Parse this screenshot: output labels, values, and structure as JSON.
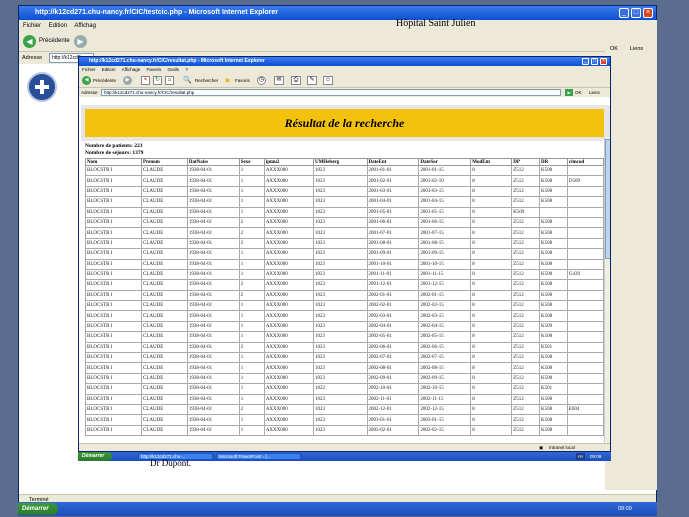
{
  "outer": {
    "title": "http://k12cd271.chu-nancy.fr/CIC/testcic.php - Microsoft Internet Explorer",
    "menu": [
      "Fichier",
      "Edition",
      "Affichag"
    ],
    "back_label": "Précédente",
    "address_label": "Adresse",
    "address_value": "http://k12cd2",
    "ok_label": "OK",
    "links_label": "Liens",
    "status_text": "Terminé",
    "slide_header": "Hôpital Saint Julien",
    "slide_signature": "Dr Dupont.",
    "taskbar": {
      "start_label": "Démarrer",
      "clock": "09:09"
    }
  },
  "inner": {
    "title": "http://k12cd271.chu-nancy.fr/CIC/resultat.php - Microsoft Internet Explorer",
    "menu": [
      "Fichier",
      "Edition",
      "Affichage",
      "Favoris",
      "Outils",
      "?"
    ],
    "toolbar": {
      "back_label": "Précédente",
      "search_label": "Rechercher",
      "favorites_label": "Favoris"
    },
    "address_label": "Adresse",
    "address_value": "http://k12cd271.chu-nancy.fr/CIC/resultat.php",
    "go_label": "OK",
    "links_label": "Liens",
    "status_right": "Intranet local",
    "taskbar": {
      "start_label": "Démarrer",
      "tasks": [
        "http://k12cd271.chu-...",
        "Microsoft PowerPoint - [..."
      ],
      "lang": "FR",
      "clock": "09:09"
    }
  },
  "result": {
    "title": "Résultat de la recherche",
    "patients_line": "Nombre de patients:  223",
    "stays_line": "Nombre de séjours:  1379",
    "columns": [
      "Nom",
      "Prenom",
      "DatNaiss",
      "Sexe",
      "ipmu2",
      "UMHeberg",
      "DateEnt",
      "DateSor",
      "ModEnt",
      "DP",
      "DR",
      "cimcod"
    ],
    "rows": [
      [
        "BLOCSTR I",
        "CLAUDE",
        "1938-04-01",
        "1",
        "AXXX000",
        "1023",
        "2001-01-01",
        "2001-01-15",
        "8",
        "Z512",
        "K508",
        ""
      ],
      [
        "BLOCSTR I",
        "CLAUDE",
        "1938-04-01",
        "1",
        "AXXX000",
        "1023",
        "2001-02-01",
        "2001-02-10",
        "8",
        "Z512",
        "K508",
        "D509"
      ],
      [
        "BLOCSTR I",
        "CLAUDE",
        "1938-04-01",
        "1",
        "AXXX000",
        "1023",
        "2001-03-01",
        "2001-03-15",
        "8",
        "Z512",
        "K508",
        ""
      ],
      [
        "BLOCSTR I",
        "CLAUDE",
        "1938-04-01",
        "1",
        "AXXX000",
        "1023",
        "2001-04-01",
        "2001-04-15",
        "8",
        "Z512",
        "K508",
        ""
      ],
      [
        "BLOCSTR I",
        "CLAUDE",
        "1938-04-01",
        "1",
        "AXXX000",
        "1023",
        "2001-05-01",
        "2001-05-15",
        "8",
        "K509",
        "",
        ""
      ],
      [
        "BLOCSTR I",
        "CLAUDE",
        "1938-04-01",
        "2",
        "AXXX000",
        "1023",
        "2001-06-01",
        "2001-06-15",
        "8",
        "Z512",
        "K508",
        ""
      ],
      [
        "BLOCSTR I",
        "CLAUDE",
        "1938-04-01",
        "2",
        "AXXX000",
        "1023",
        "2001-07-01",
        "2001-07-15",
        "8",
        "Z512",
        "K508",
        ""
      ],
      [
        "BLOCSTR I",
        "CLAUDE",
        "1938-04-01",
        "2",
        "AXXX000",
        "1023",
        "2001-08-01",
        "2001-08-15",
        "8",
        "Z512",
        "K508",
        ""
      ],
      [
        "BLOCSTR I",
        "CLAUDE",
        "1938-04-01",
        "1",
        "AXXX000",
        "1023",
        "2001-09-01",
        "2001-09-15",
        "8",
        "Z512",
        "K508",
        ""
      ],
      [
        "BLOCSTR I",
        "CLAUDE",
        "1938-04-01",
        "1",
        "AXXX000",
        "1023",
        "2001-10-01",
        "2001-10-15",
        "8",
        "Z512",
        "K508",
        ""
      ],
      [
        "BLOCSTR I",
        "CLAUDE",
        "1938-04-01",
        "1",
        "AXXX000",
        "1023",
        "2001-11-01",
        "2001-11-15",
        "8",
        "Z512",
        "K508",
        "G439"
      ],
      [
        "BLOCSTR I",
        "CLAUDE",
        "1938-04-01",
        "2",
        "AXXX000",
        "1023",
        "2001-12-01",
        "2001-12-15",
        "8",
        "Z512",
        "K508",
        ""
      ],
      [
        "BLOCSTR I",
        "CLAUDE",
        "1938-04-01",
        "2",
        "AXXX000",
        "1023",
        "2002-01-01",
        "2002-01-15",
        "8",
        "Z512",
        "K508",
        ""
      ],
      [
        "BLOCSTR I",
        "CLAUDE",
        "1938-04-01",
        "1",
        "AXXX000",
        "1023",
        "2002-02-01",
        "2002-02-15",
        "8",
        "Z512",
        "K508",
        ""
      ],
      [
        "BLOCSTR I",
        "CLAUDE",
        "1938-04-01",
        "1",
        "AXXX000",
        "1023",
        "2002-03-01",
        "2002-03-15",
        "8",
        "Z512",
        "K508",
        ""
      ],
      [
        "BLOCSTR I",
        "CLAUDE",
        "1938-04-01",
        "1",
        "AXXX000",
        "1023",
        "2002-04-01",
        "2002-04-15",
        "8",
        "Z512",
        "K509",
        ""
      ],
      [
        "BLOCSTR I",
        "CLAUDE",
        "1938-04-01",
        "1",
        "AXXX000",
        "1023",
        "2002-05-01",
        "2002-05-15",
        "8",
        "Z512",
        "K508",
        ""
      ],
      [
        "BLOCSTR I",
        "CLAUDE",
        "1938-04-01",
        "2",
        "AXXX000",
        "1023",
        "2002-06-01",
        "2002-06-15",
        "8",
        "Z512",
        "K501",
        ""
      ],
      [
        "BLOCSTR I",
        "CLAUDE",
        "1938-04-01",
        "1",
        "AXXX000",
        "1023",
        "2002-07-01",
        "2002-07-15",
        "8",
        "Z512",
        "K508",
        ""
      ],
      [
        "BLOCSTR I",
        "CLAUDE",
        "1938-04-01",
        "1",
        "AXXX000",
        "1023",
        "2002-08-01",
        "2002-08-15",
        "8",
        "Z512",
        "K508",
        ""
      ],
      [
        "BLOCSTR I",
        "CLAUDE",
        "1938-04-01",
        "1",
        "AXXX000",
        "1023",
        "2002-09-01",
        "2002-09-15",
        "8",
        "Z512",
        "K508",
        ""
      ],
      [
        "BLOCSTR I",
        "CLAUDE",
        "1938-04-01",
        "1",
        "AXXX000",
        "1022",
        "2002-10-01",
        "2002-10-15",
        "8",
        "Z512",
        "K501",
        ""
      ],
      [
        "BLOCSTR I",
        "CLAUDE",
        "1938-04-01",
        "1",
        "AXXX000",
        "1023",
        "2002-11-01",
        "2002-11-15",
        "8",
        "Z512",
        "K508",
        ""
      ],
      [
        "BLOCSTR I",
        "CLAUDE",
        "1938-04-01",
        "2",
        "AXXX000",
        "1023",
        "2002-12-01",
        "2002-12-15",
        "8",
        "Z512",
        "K508",
        "E604"
      ],
      [
        "BLOCSTR I",
        "CLAUDE",
        "1938-04-01",
        "1",
        "AXXX000",
        "1023",
        "2003-01-01",
        "2003-01-15",
        "8",
        "Z512",
        "K508",
        ""
      ],
      [
        "BLOCSTR I",
        "CLAUDE",
        "1938-04-01",
        "1",
        "AXXX000",
        "1023",
        "2003-02-01",
        "2003-02-15",
        "8",
        "Z512",
        "K508",
        ""
      ]
    ]
  }
}
